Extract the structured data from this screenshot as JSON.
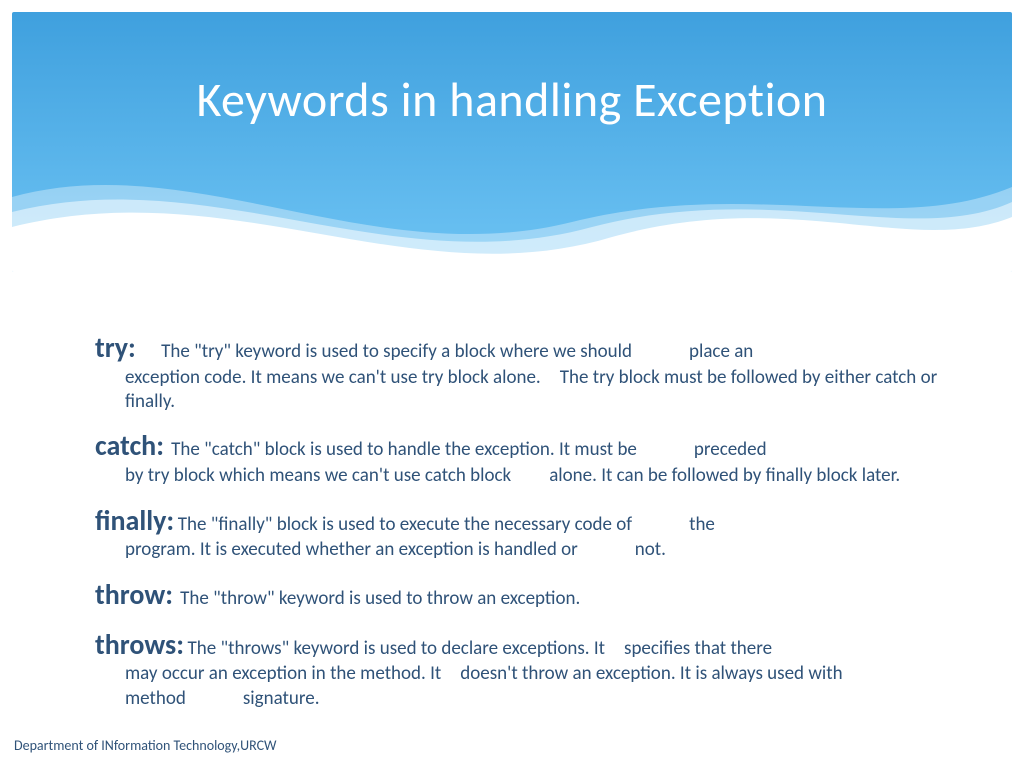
{
  "title": "Keywords in handling Exception",
  "items": [
    {
      "keyword": "try:",
      "line1": "The \"try\" keyword is used to specify a block where we should   place an",
      "cont": "exception code. It means we can't use try block alone. The try block must be followed by either catch or finally."
    },
    {
      "keyword": "catch:",
      "line1": "The \"catch\" block is used to handle the exception. It must be   preceded",
      "cont": "by try block which means we can't use catch block  alone. It can be followed by finally block later."
    },
    {
      "keyword": "finally:",
      "line1": "The \"finally\" block is used to execute the necessary code of   the",
      "cont": "program. It is executed whether an exception is handled or   not."
    },
    {
      "keyword": "throw:",
      "line1": "The \"throw\" keyword is used to throw an exception.",
      "cont": ""
    },
    {
      "keyword": "throws:",
      "line1": "The \"throws\" keyword is used to declare exceptions. It specifies that there",
      "cont": "may occur an exception in the method. It doesn't throw an exception. It is always used with method   signature."
    }
  ],
  "footer": "Department of INformation Technology,URCW"
}
